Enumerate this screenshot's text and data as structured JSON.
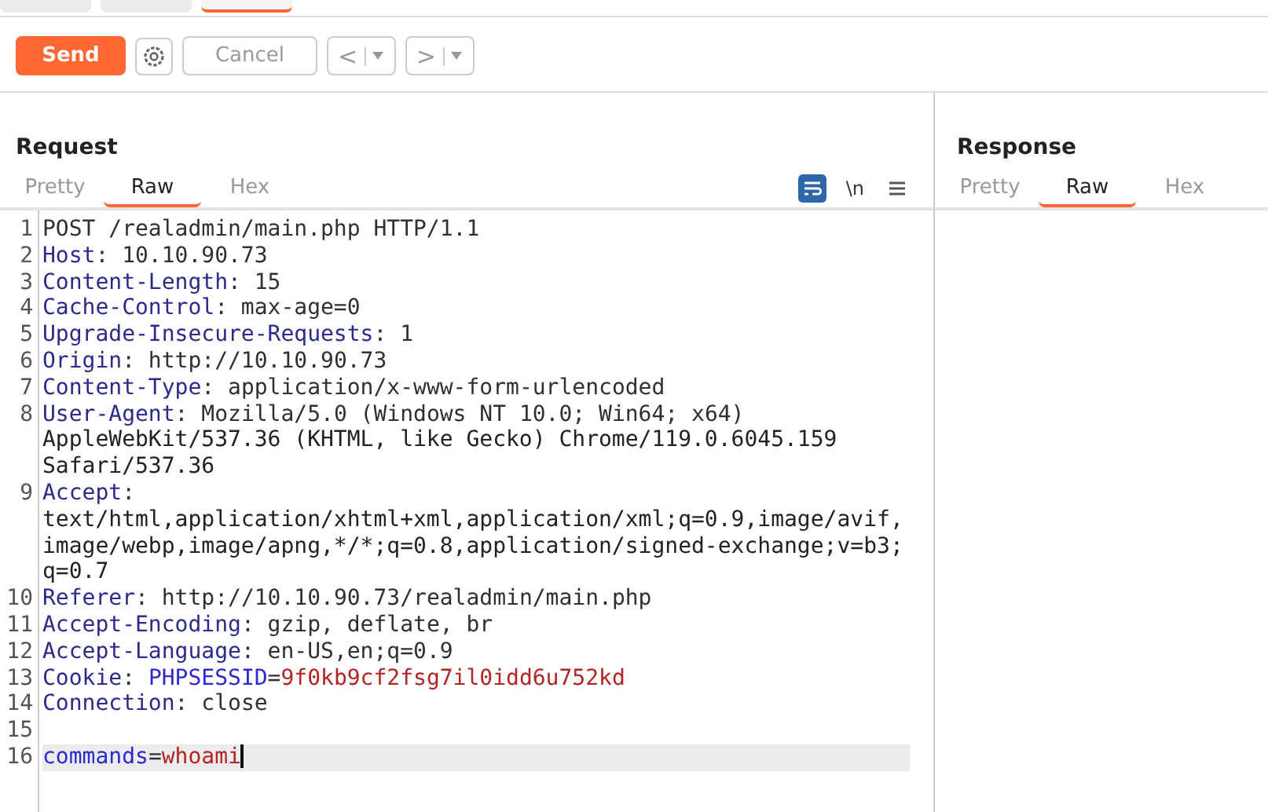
{
  "top_tabs": [
    {
      "selected": false
    },
    {
      "selected": false
    },
    {
      "selected": true
    }
  ],
  "toolbar": {
    "send": "Send",
    "cancel": "Cancel",
    "back": "<",
    "forward": ">"
  },
  "request": {
    "title": "Request",
    "tabs": [
      {
        "label": "Pretty",
        "selected": false
      },
      {
        "label": "Raw",
        "selected": true
      },
      {
        "label": "Hex",
        "selected": false
      }
    ],
    "wrap_on": true,
    "newline_label": "\\n",
    "lines": [
      {
        "number": "1",
        "current": false,
        "segments": [
          {
            "kind": "plain",
            "text": "POST /realadmin/main.php HTTP/1.1"
          }
        ]
      },
      {
        "number": "2",
        "current": false,
        "segments": [
          {
            "kind": "key",
            "text": "Host"
          },
          {
            "kind": "plain",
            "text": ": 10.10.90.73"
          }
        ]
      },
      {
        "number": "3",
        "current": false,
        "segments": [
          {
            "kind": "key",
            "text": "Content-Length"
          },
          {
            "kind": "plain",
            "text": ": 15"
          }
        ]
      },
      {
        "number": "4",
        "current": false,
        "segments": [
          {
            "kind": "key",
            "text": "Cache-Control"
          },
          {
            "kind": "plain",
            "text": ": max-age=0"
          }
        ]
      },
      {
        "number": "5",
        "current": false,
        "segments": [
          {
            "kind": "key",
            "text": "Upgrade-Insecure-Requests"
          },
          {
            "kind": "plain",
            "text": ": 1"
          }
        ]
      },
      {
        "number": "6",
        "current": false,
        "segments": [
          {
            "kind": "key",
            "text": "Origin"
          },
          {
            "kind": "plain",
            "text": ": http://10.10.90.73"
          }
        ]
      },
      {
        "number": "7",
        "current": false,
        "segments": [
          {
            "kind": "key",
            "text": "Content-Type"
          },
          {
            "kind": "plain",
            "text": ": application/x-www-form-urlencoded"
          }
        ]
      },
      {
        "number": "8",
        "current": false,
        "segments": [
          {
            "kind": "key",
            "text": "User-Agent"
          },
          {
            "kind": "plain",
            "text": ": Mozilla/5.0 (Windows NT 10.0; Win64; x64)"
          }
        ],
        "continuation": [
          "AppleWebKit/537.36 (KHTML, like Gecko) Chrome/119.0.6045.159",
          "Safari/537.36"
        ]
      },
      {
        "number": "9",
        "current": false,
        "segments": [
          {
            "kind": "key",
            "text": "Accept"
          },
          {
            "kind": "plain",
            "text": ":"
          }
        ],
        "continuation": [
          "text/html,application/xhtml+xml,application/xml;q=0.9,image/avif,",
          "image/webp,image/apng,*/*;q=0.8,application/signed-exchange;v=b3;",
          "q=0.7"
        ]
      },
      {
        "number": "10",
        "current": false,
        "segments": [
          {
            "kind": "key",
            "text": "Referer"
          },
          {
            "kind": "plain",
            "text": ": http://10.10.90.73/realadmin/main.php"
          }
        ]
      },
      {
        "number": "11",
        "current": false,
        "segments": [
          {
            "kind": "key",
            "text": "Accept-Encoding"
          },
          {
            "kind": "plain",
            "text": ": gzip, deflate, br"
          }
        ]
      },
      {
        "number": "12",
        "current": false,
        "segments": [
          {
            "kind": "key",
            "text": "Accept-Language"
          },
          {
            "kind": "plain",
            "text": ": en-US,en;q=0.9"
          }
        ]
      },
      {
        "number": "13",
        "current": false,
        "segments": [
          {
            "kind": "key",
            "text": "Cookie"
          },
          {
            "kind": "plain",
            "text": ": "
          },
          {
            "kind": "param",
            "text": "PHPSESSID"
          },
          {
            "kind": "plain",
            "text": "="
          },
          {
            "kind": "paramvalue",
            "text": "9f0kb9cf2fsg7il0idd6u752kd"
          }
        ]
      },
      {
        "number": "14",
        "current": false,
        "segments": [
          {
            "kind": "key",
            "text": "Connection"
          },
          {
            "kind": "plain",
            "text": ": close"
          }
        ]
      },
      {
        "number": "15",
        "current": false
      },
      {
        "number": "16",
        "current": true,
        "segments": [
          {
            "kind": "param",
            "text": "commands"
          },
          {
            "kind": "plain",
            "text": "="
          },
          {
            "kind": "paramvalue",
            "text": "whoami"
          }
        ]
      }
    ]
  },
  "response": {
    "title": "Response",
    "tabs": [
      {
        "label": "Pretty",
        "selected": false
      },
      {
        "label": "Raw",
        "selected": true
      },
      {
        "label": "Hex",
        "selected": false
      }
    ]
  }
}
